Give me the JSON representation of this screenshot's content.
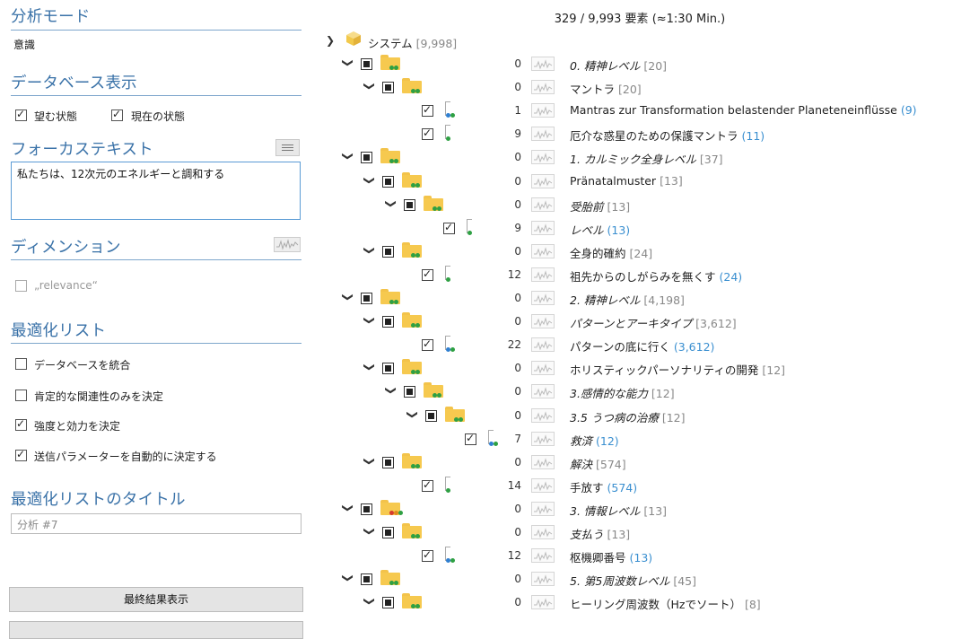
{
  "left": {
    "analysis_mode": {
      "title": "分析モード",
      "value": "意識"
    },
    "db_display": {
      "title": "データベース表示",
      "desired": {
        "label": "望む状態",
        "checked": true
      },
      "current": {
        "label": "現在の状態",
        "checked": true
      }
    },
    "focus": {
      "title": "フォーカステキスト",
      "text": "私たちは、12次元のエネルギーと調和する"
    },
    "dimension": {
      "title": "ディメンション",
      "relevance": {
        "label": "„relevance“",
        "checked": false
      }
    },
    "opt_list": {
      "title": "最適化リスト",
      "items": [
        {
          "label": "データベースを統合",
          "checked": false
        },
        {
          "label": "肯定的な関連性のみを決定",
          "checked": false
        },
        {
          "label": "強度と効力を決定",
          "checked": true
        },
        {
          "label": "送信パラメーターを自動的に決定する",
          "checked": true
        }
      ]
    },
    "opt_title": {
      "title": "最適化リストのタイトル",
      "placeholder": "分析 #7"
    },
    "show_final_button": "最終結果表示"
  },
  "right": {
    "summary": "329 / 9,993 要素 (≈1:30 Min.)",
    "root": {
      "label": "システム",
      "count": "[9,998]"
    },
    "rows": [
      {
        "depth": 0,
        "kind": "folder",
        "count": "0",
        "label": "0. 精神レベル",
        "extra": "[20]",
        "italic": true,
        "bluecount": false,
        "dots": [
          "green",
          "green"
        ]
      },
      {
        "depth": 1,
        "kind": "folder",
        "count": "0",
        "label": "マントラ",
        "extra": "[20]",
        "italic": false,
        "bluecount": false,
        "dots": [
          "green",
          "green"
        ]
      },
      {
        "depth": 2,
        "kind": "doc",
        "count": "1",
        "label": "Mantras zur Transformation belastender Planeteneinflüsse",
        "extra": "(9)",
        "italic": false,
        "bluecount": true,
        "dots": [
          "blue",
          "green"
        ]
      },
      {
        "depth": 2,
        "kind": "doc",
        "count": "9",
        "label": "厄介な惑星のための保護マントラ",
        "extra": "(11)",
        "italic": false,
        "bluecount": true,
        "dots": [
          "green"
        ]
      },
      {
        "depth": 0,
        "kind": "folder",
        "count": "0",
        "label": "1. カルミック全身レベル",
        "extra": "[37]",
        "italic": true,
        "bluecount": false,
        "dots": [
          "green",
          "green"
        ]
      },
      {
        "depth": 1,
        "kind": "folder",
        "count": "0",
        "label": "Pränatalmuster",
        "extra": "[13]",
        "italic": false,
        "bluecount": false,
        "dots": [
          "green",
          "green"
        ]
      },
      {
        "depth": 2,
        "kind": "folder",
        "count": "0",
        "label": "受胎前",
        "extra": "[13]",
        "italic": true,
        "bluecount": false,
        "dots": [
          "green",
          "green"
        ]
      },
      {
        "depth": 3,
        "kind": "doc",
        "count": "9",
        "label": "レベル",
        "extra": "(13)",
        "italic": true,
        "bluecount": true,
        "dots": [
          "green"
        ]
      },
      {
        "depth": 1,
        "kind": "folder",
        "count": "0",
        "label": "全身的確約",
        "extra": "[24]",
        "italic": false,
        "bluecount": false,
        "dots": [
          "green",
          "green"
        ]
      },
      {
        "depth": 2,
        "kind": "doc",
        "count": "12",
        "label": "祖先からのしがらみを無くす",
        "extra": "(24)",
        "italic": false,
        "bluecount": true,
        "dots": [
          "green"
        ]
      },
      {
        "depth": 0,
        "kind": "folder",
        "count": "0",
        "label": "2. 精神レベル",
        "extra": "[4,198]",
        "italic": true,
        "bluecount": false,
        "dots": [
          "green",
          "green"
        ]
      },
      {
        "depth": 1,
        "kind": "folder",
        "count": "0",
        "label": "パターンとアーキタイプ",
        "extra": "[3,612]",
        "italic": true,
        "bluecount": false,
        "dots": [
          "green",
          "green"
        ]
      },
      {
        "depth": 2,
        "kind": "doc",
        "count": "22",
        "label": "パターンの底に行く",
        "extra": "(3,612)",
        "italic": false,
        "bluecount": true,
        "dots": [
          "blue",
          "green"
        ]
      },
      {
        "depth": 1,
        "kind": "folder",
        "count": "0",
        "label": "ホリスティックパーソナリティの開発",
        "extra": "[12]",
        "italic": false,
        "bluecount": false,
        "dots": [
          "green",
          "green"
        ]
      },
      {
        "depth": 2,
        "kind": "folder",
        "count": "0",
        "label": "3.感情的な能力",
        "extra": "[12]",
        "italic": true,
        "bluecount": false,
        "dots": [
          "green",
          "green"
        ]
      },
      {
        "depth": 3,
        "kind": "folder",
        "count": "0",
        "label": "3.5 うつ病の治療",
        "extra": "[12]",
        "italic": true,
        "bluecount": false,
        "dots": [
          "green",
          "green"
        ]
      },
      {
        "depth": 4,
        "kind": "doc",
        "count": "7",
        "label": "救済",
        "extra": "(12)",
        "italic": true,
        "bluecount": true,
        "dots": [
          "blue",
          "green"
        ]
      },
      {
        "depth": 1,
        "kind": "folder",
        "count": "0",
        "label": "解決",
        "extra": "[574]",
        "italic": true,
        "bluecount": false,
        "dots": [
          "green",
          "green"
        ]
      },
      {
        "depth": 2,
        "kind": "doc",
        "count": "14",
        "label": "手放す",
        "extra": "(574)",
        "italic": false,
        "bluecount": true,
        "dots": [
          "green"
        ]
      },
      {
        "depth": 0,
        "kind": "folder",
        "count": "0",
        "label": "3. 情報レベル",
        "extra": "[13]",
        "italic": true,
        "bluecount": false,
        "dots": [
          "red",
          "orange",
          "green"
        ]
      },
      {
        "depth": 1,
        "kind": "folder",
        "count": "0",
        "label": "支払う",
        "extra": "[13]",
        "italic": true,
        "bluecount": false,
        "dots": [
          "green",
          "green"
        ]
      },
      {
        "depth": 2,
        "kind": "doc",
        "count": "12",
        "label": "枢機卿番号",
        "extra": "(13)",
        "italic": false,
        "bluecount": true,
        "dots": [
          "blue",
          "green"
        ]
      },
      {
        "depth": 0,
        "kind": "folder",
        "count": "0",
        "label": "5. 第5周波数レベル",
        "extra": "[45]",
        "italic": true,
        "bluecount": false,
        "dots": [
          "green",
          "green"
        ]
      },
      {
        "depth": 1,
        "kind": "folder",
        "count": "0",
        "label": "ヒーリング周波数（Hzでソート）",
        "extra": "[8]",
        "italic": false,
        "bluecount": false,
        "dots": [
          "green",
          "green"
        ]
      }
    ]
  },
  "colors": {
    "accent": "#3a72a8",
    "link": "#3a8fd0",
    "folder": "#f6c94f",
    "green": "#2ea043",
    "blue": "#2f7fd0",
    "red": "#d63a2e",
    "orange": "#e08a1e"
  }
}
